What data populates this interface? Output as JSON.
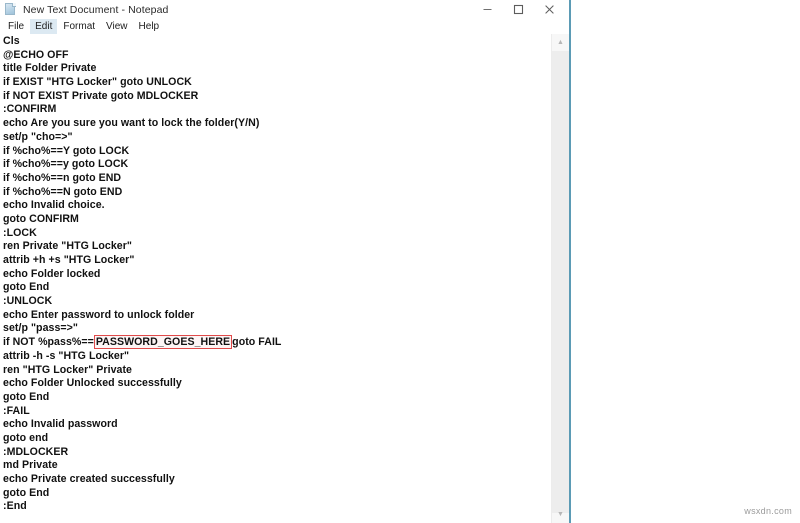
{
  "window": {
    "title": "New Text Document - Notepad",
    "icon": "notepad-document-icon",
    "controls": {
      "minimize_label": "Minimize",
      "maximize_label": "Maximize",
      "close_label": "Close"
    }
  },
  "menubar": {
    "items": [
      {
        "label": "File",
        "active": false
      },
      {
        "label": "Edit",
        "active": true
      },
      {
        "label": "Format",
        "active": false
      },
      {
        "label": "View",
        "active": false
      },
      {
        "label": "Help",
        "active": false
      }
    ]
  },
  "editor": {
    "lines": [
      "Cls",
      "@ECHO OFF",
      "title Folder Private",
      "if EXIST \"HTG Locker\" goto UNLOCK",
      "if NOT EXIST Private goto MDLOCKER",
      ":CONFIRM",
      "echo Are you sure you want to lock the folder(Y/N)",
      "set/p \"cho=>\"",
      "if %cho%==Y goto LOCK",
      "if %cho%==y goto LOCK",
      "if %cho%==n goto END",
      "if %cho%==N goto END",
      "echo Invalid choice.",
      "goto CONFIRM",
      ":LOCK",
      "ren Private \"HTG Locker\"",
      "attrib +h +s \"HTG Locker\"",
      "echo Folder locked",
      "goto End",
      ":UNLOCK",
      "echo Enter password to unlock folder",
      "set/p \"pass=>\"",
      "__HIGHLIGHT_LINE__",
      "attrib -h -s \"HTG Locker\"",
      "ren \"HTG Locker\" Private",
      "echo Folder Unlocked successfully",
      "goto End",
      ":FAIL",
      "echo Invalid password",
      "goto end",
      ":MDLOCKER",
      "md Private",
      "echo Private created successfully",
      "goto End",
      ":End"
    ],
    "highlight_line": {
      "index": 22,
      "prefix": "if NOT %pass%==",
      "token": "PASSWORD_GOES_HERE",
      "suffix": "goto FAIL",
      "box_color": "#e04a4a"
    },
    "scrollbar": {
      "up_arrow": "scroll-up-icon",
      "down_arrow": "scroll-down-icon"
    }
  },
  "watermark": {
    "text": "wsxdn.com"
  }
}
